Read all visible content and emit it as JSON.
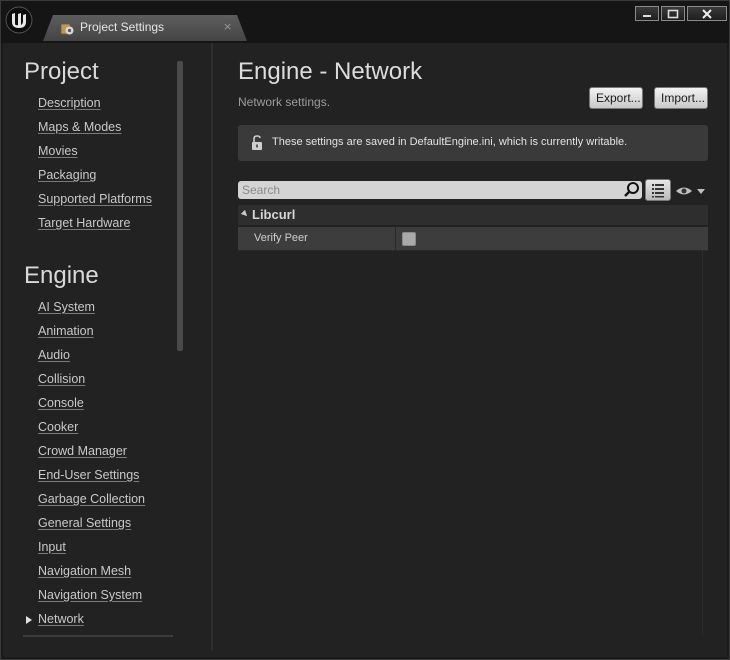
{
  "window": {
    "tab_title": "Project Settings",
    "tab_close": "×",
    "controls": {
      "minimize": "minimize",
      "maximize": "maximize",
      "close": "close"
    }
  },
  "sidebar": {
    "sections": [
      {
        "title": "Project",
        "items": [
          {
            "label": "Description"
          },
          {
            "label": "Maps & Modes"
          },
          {
            "label": "Movies"
          },
          {
            "label": "Packaging"
          },
          {
            "label": "Supported Platforms"
          },
          {
            "label": "Target Hardware"
          }
        ]
      },
      {
        "title": "Engine",
        "items": [
          {
            "label": "AI System"
          },
          {
            "label": "Animation"
          },
          {
            "label": "Audio"
          },
          {
            "label": "Collision"
          },
          {
            "label": "Console"
          },
          {
            "label": "Cooker"
          },
          {
            "label": "Crowd Manager"
          },
          {
            "label": "End-User Settings"
          },
          {
            "label": "Garbage Collection"
          },
          {
            "label": "General Settings"
          },
          {
            "label": "Input"
          },
          {
            "label": "Navigation Mesh"
          },
          {
            "label": "Navigation System"
          },
          {
            "label": "Network",
            "selected": true
          }
        ]
      }
    ]
  },
  "main": {
    "title": "Engine - Network",
    "subtitle": "Network settings.",
    "export_label": "Export...",
    "import_label": "Import...",
    "notice": "These settings are saved in DefaultEngine.ini, which is currently writable.",
    "search": {
      "placeholder": "Search",
      "value": ""
    },
    "categories": [
      {
        "name": "Libcurl",
        "properties": [
          {
            "name": "Verify Peer",
            "type": "checkbox",
            "checked": false
          }
        ]
      }
    ]
  },
  "colors": {
    "background": "#222222",
    "titlebar": "#151515",
    "notice_bg": "#3a3a3a",
    "row_bg": "#3d3d3d"
  },
  "icons": [
    "unreal-logo-icon",
    "settings-gear-icon",
    "close-icon",
    "minimize-icon",
    "maximize-icon",
    "unlock-icon",
    "search-icon",
    "list-view-icon",
    "eye-icon",
    "chevron-down-icon",
    "expand-arrow-icon",
    "selected-arrow-icon"
  ]
}
